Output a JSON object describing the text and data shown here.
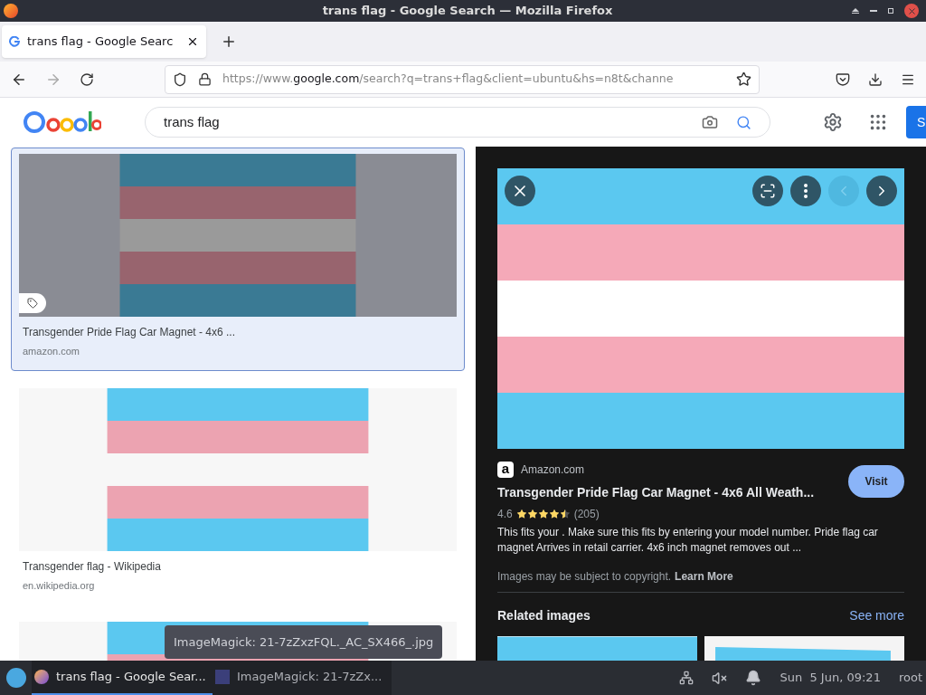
{
  "window": {
    "title": "trans flag - Google Search — Mozilla Firefox"
  },
  "tabs": [
    {
      "label": "trans flag - Google Searc",
      "selected": true
    }
  ],
  "address_bar": {
    "url_prefix": "https://www.",
    "url_domain": "google.com",
    "url_rest": "/search?q=trans+flag&client=ubuntu&hs=n8t&channe"
  },
  "google_header": {
    "search_value": "trans flag",
    "sign_in_label": "S"
  },
  "results": [
    {
      "title": "Transgender Pride Flag Car Magnet - 4x6 ...",
      "source": "amazon.com",
      "selected": true
    },
    {
      "title": "Transgender flag - Wikipedia",
      "source": "en.wikipedia.org",
      "selected": false
    },
    {
      "selected": false
    }
  ],
  "preview": {
    "nav_buttons": [
      {
        "kind": "lens",
        "disabled": false
      },
      {
        "kind": "more",
        "disabled": false
      },
      {
        "kind": "prev",
        "disabled": true
      },
      {
        "kind": "next",
        "disabled": false
      }
    ],
    "source_logo": "a",
    "source": "Amazon.com",
    "title": "Transgender Pride Flag Car Magnet - 4x6 All Weath...",
    "rating": "4.6",
    "stars": 4.5,
    "review_count": "(205)",
    "description": "This fits your . Make sure this fits by entering your model number. Pride flag car magnet Arrives in retail carrier. 4x6 inch magnet removes out ...",
    "copyright": "Images may be subject to copyright.",
    "learn_more": "Learn More",
    "visit": "Visit",
    "related_title": "Related images",
    "see_more": "See more"
  },
  "tooltip": "ImageMagick: 21-7zZxzFQL._AC_SX466_.jpg",
  "taskbar": {
    "items": [
      {
        "kind": "firefox",
        "label": "trans flag - Google Sear...",
        "selected": true
      },
      {
        "kind": "imagemagick",
        "label": "ImageMagick: 21-7zZx...",
        "selected": false
      }
    ],
    "clock": "Sun  5 Jun, 09:21",
    "user": "root"
  }
}
